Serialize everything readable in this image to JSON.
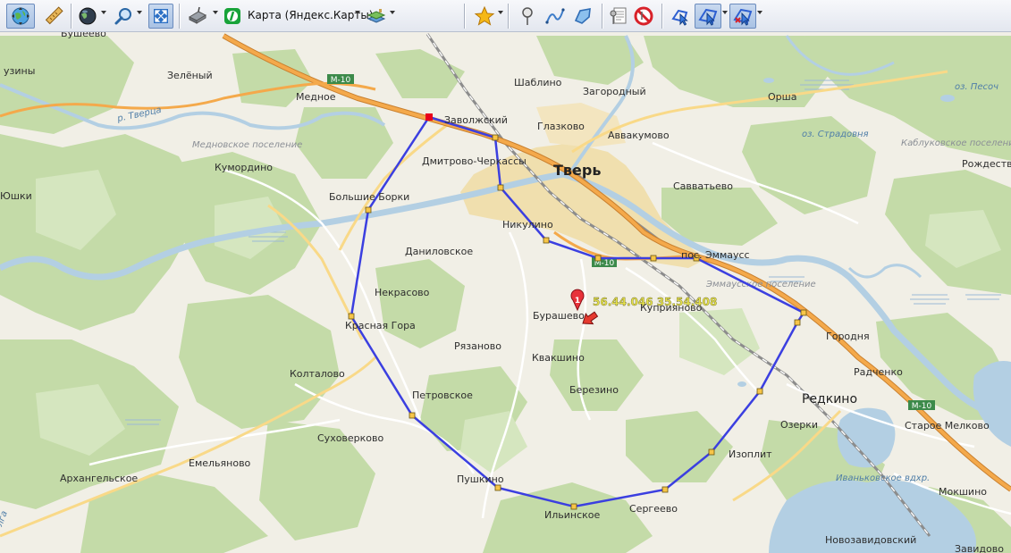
{
  "toolbar": {
    "map_provider": "Карта (Яндекс.Карты)",
    "buttons": [
      "navigation-mode",
      "ruler",
      "globe",
      "zoom",
      "fit-extent",
      "gps-device",
      "map-source",
      "layers",
      "favorites",
      "placemark",
      "path",
      "polygon",
      "marks-list",
      "hide-marks",
      "select-tool",
      "edit-poly-tool",
      "delete-poly-tool"
    ]
  },
  "map": {
    "colors": {
      "background": "#f1efe6",
      "forest": "#c4dba8",
      "water": "#b3cfe3",
      "city": "#f0dfae",
      "highway": "#f4a94b",
      "polygon": "#3b3fe0",
      "vertex": "#f7c548",
      "start_vertex": "#e8001c",
      "cursor_marker": "#e63a2f"
    },
    "marker": {
      "number": "1",
      "coords": "56.44.046 35.54.408"
    },
    "city_title": "Тверь",
    "road_shields": [
      {
        "id": "m10-a",
        "label": "М-10"
      },
      {
        "id": "m10-b",
        "label": "М-10"
      },
      {
        "id": "m10-c",
        "label": "М-10"
      }
    ],
    "settlements": [
      {
        "id": "busheevo",
        "label": "Бушеево"
      },
      {
        "id": "uziny",
        "label": "узины"
      },
      {
        "id": "zelenyj",
        "label": "Зелёный"
      },
      {
        "id": "mednoe",
        "label": "Медное"
      },
      {
        "id": "zavolzhskij",
        "label": "Заволжский"
      },
      {
        "id": "shablino",
        "label": "Шаблино"
      },
      {
        "id": "zagorodnyj",
        "label": "Загородный"
      },
      {
        "id": "orsha",
        "label": "Орша"
      },
      {
        "id": "glazkovo",
        "label": "Глазково"
      },
      {
        "id": "avvakumovo",
        "label": "Аввакумово"
      },
      {
        "id": "kumordino",
        "label": "Кумордино"
      },
      {
        "id": "dmitrovo",
        "label": "Дмитрово-Черкассы"
      },
      {
        "id": "savvatevo",
        "label": "Савватьево"
      },
      {
        "id": "rozhdestveno",
        "label": "Рождестве"
      },
      {
        "id": "oshki",
        "label": "Юшки"
      },
      {
        "id": "bolshie-borki",
        "label": "Большие Борки"
      },
      {
        "id": "nikulino",
        "label": "Никулино"
      },
      {
        "id": "danilovskoe",
        "label": "Даниловское"
      },
      {
        "id": "emmauss",
        "label": "пос. Эммаусс"
      },
      {
        "id": "nekrasovo",
        "label": "Некрасово"
      },
      {
        "id": "burashevo",
        "label": "Бурашево"
      },
      {
        "id": "kuprijanovo",
        "label": "Куприяново"
      },
      {
        "id": "krasnaja-gora",
        "label": "Красная Гора"
      },
      {
        "id": "gorodnja",
        "label": "Городня"
      },
      {
        "id": "rjazanovo",
        "label": "Рязаново"
      },
      {
        "id": "koltalovo",
        "label": "Колталово"
      },
      {
        "id": "kvakshino",
        "label": "Квакшино"
      },
      {
        "id": "radchenko",
        "label": "Радченко"
      },
      {
        "id": "berezino",
        "label": "Березино"
      },
      {
        "id": "petrovskoe",
        "label": "Петровское"
      },
      {
        "id": "redkino",
        "label": "Редкино"
      },
      {
        "id": "ozerki",
        "label": "Озерки"
      },
      {
        "id": "staroe-melkovo",
        "label": "Старое Мелково"
      },
      {
        "id": "suhoverkovo",
        "label": "Суховерково"
      },
      {
        "id": "izoplit",
        "label": "Изоплит"
      },
      {
        "id": "emeljanovo",
        "label": "Емельяново"
      },
      {
        "id": "arhangelskoe",
        "label": "Архангельское"
      },
      {
        "id": "pushkino",
        "label": "Пушкино"
      },
      {
        "id": "sergeevo",
        "label": "Сергеево"
      },
      {
        "id": "mokshino",
        "label": "Мокшино"
      },
      {
        "id": "ilinskoe",
        "label": "Ильинское"
      },
      {
        "id": "novozavidovskij",
        "label": "Новозавидовский"
      },
      {
        "id": "zavidovo",
        "label": "Завидово"
      }
    ],
    "areas": [
      {
        "id": "mednovskoe",
        "label": "Медновское поселение"
      },
      {
        "id": "emmausskoe",
        "label": "Эммаусское поселение"
      },
      {
        "id": "kablukovskoe",
        "label": "Каблуковское поселение"
      }
    ],
    "water_labels": [
      {
        "id": "r-tverca",
        "label": "р. Тверца"
      },
      {
        "id": "oz-pesochnoe",
        "label": "оз. Песоч"
      },
      {
        "id": "oz-stradovnja",
        "label": "оз. Страдовня"
      },
      {
        "id": "ivankovskoe",
        "label": "Иваньковское вдхр."
      },
      {
        "id": "volga-left",
        "label": "лга"
      }
    ]
  }
}
